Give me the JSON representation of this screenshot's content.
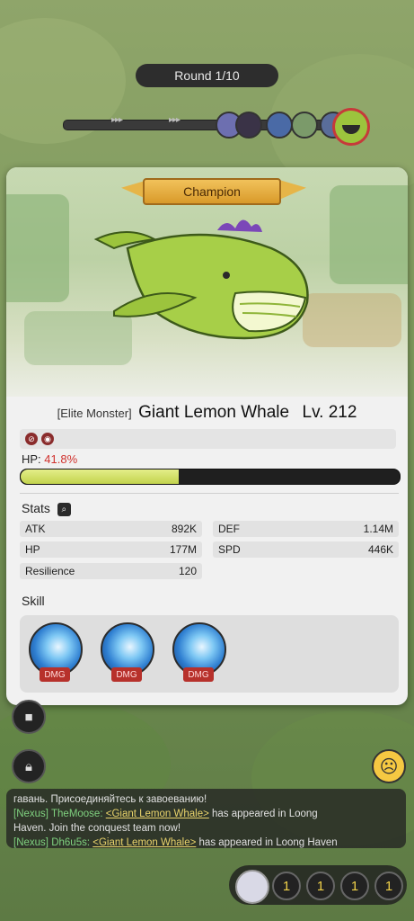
{
  "hud": {
    "round_text": "Round 1/10",
    "arrows_a": "▸▸▸",
    "arrows_b": "▸▸▸"
  },
  "card": {
    "badge": "Champion",
    "elite_tag": "[Elite Monster]",
    "monster_name": "Giant Lemon Whale",
    "level": "Lv. 212",
    "hp_label": "HP:",
    "hp_percent_text": "41.8%",
    "hp_fraction": 0.418,
    "stats_title": "Stats",
    "stats": {
      "atk_label": "ATK",
      "atk_value": "892K",
      "def_label": "DEF",
      "def_value": "1.14M",
      "hp_label": "HP",
      "hp_value": "177M",
      "spd_label": "SPD",
      "spd_value": "446K",
      "res_label": "Resilience",
      "res_value": "120"
    },
    "skill_title": "Skill",
    "skills": [
      {
        "tag": "DMG"
      },
      {
        "tag": "DMG"
      },
      {
        "tag": "DMG"
      }
    ]
  },
  "chat": {
    "line1": "гавань. Присоединяйтесь к завоеванию!",
    "line2_channel": "[Nexus]",
    "line2_user": "TheMoose:",
    "line2_link": "<Giant Lemon Whale>",
    "line2_text": "has appeared in Loong",
    "line3": "Haven. Join the conquest team now!",
    "line4_channel": "[Nexus]",
    "line4_user": "Dh6u5s:",
    "line4_link": "<Giant Lemon Whale>",
    "line4_text": "has appeared in Loong Haven"
  },
  "bottom": {
    "counts": [
      "1",
      "1",
      "1",
      "1"
    ]
  },
  "colors": {
    "hp_fill": "#c2d34c",
    "hp_percent": "#d0322e",
    "dmg_tag": "#b7312b",
    "badge_gold": "#e6b548"
  },
  "icons": [
    "video-camera-icon",
    "lock-icon",
    "emoji-face-icon",
    "magnifier-icon"
  ]
}
